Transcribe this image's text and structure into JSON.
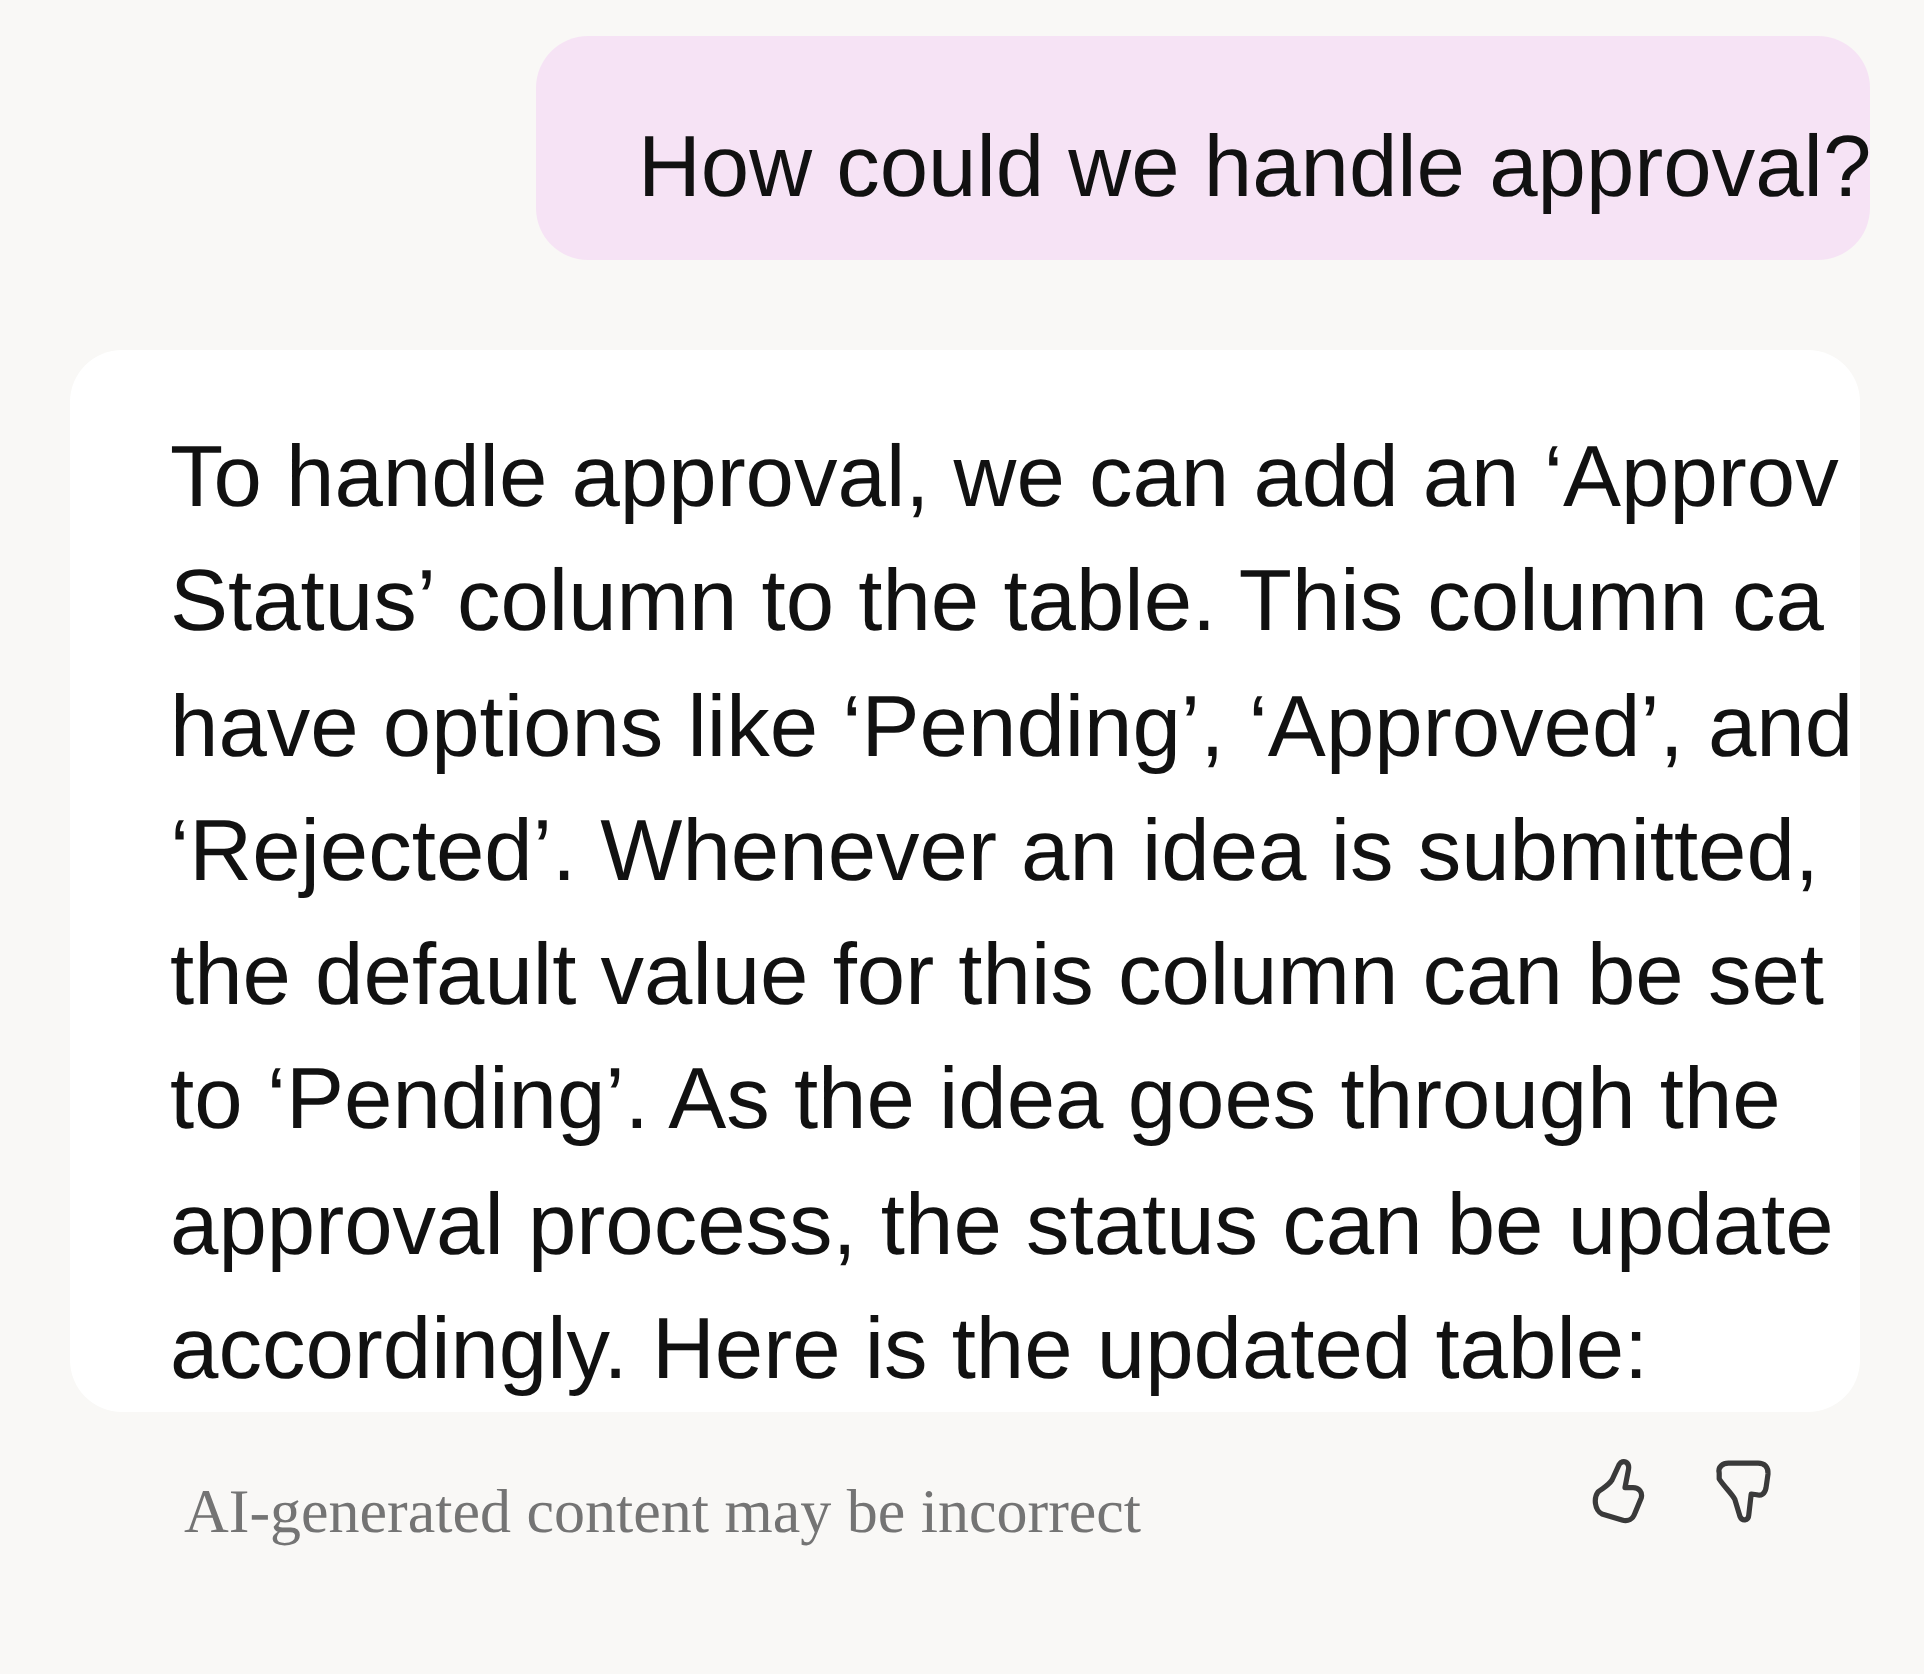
{
  "messages": [
    {
      "kind": "user",
      "text": "How could we handle approval?"
    },
    {
      "kind": "assistant",
      "lines": [
        "To handle approval, we can add an ‘Approv",
        "Status’ column to the table. This column ca",
        "have options like ‘Pending’, ‘Approved’, and",
        "‘Rejected’. Whenever an idea is submitted,",
        "the default value for this column can be set",
        "to ‘Pending’. As the idea goes through the",
        "approval process, the status can be update",
        "accordingly. Here is the updated table:"
      ]
    }
  ],
  "footer": {
    "disclaimer": "AI-generated content may be incorrect"
  }
}
